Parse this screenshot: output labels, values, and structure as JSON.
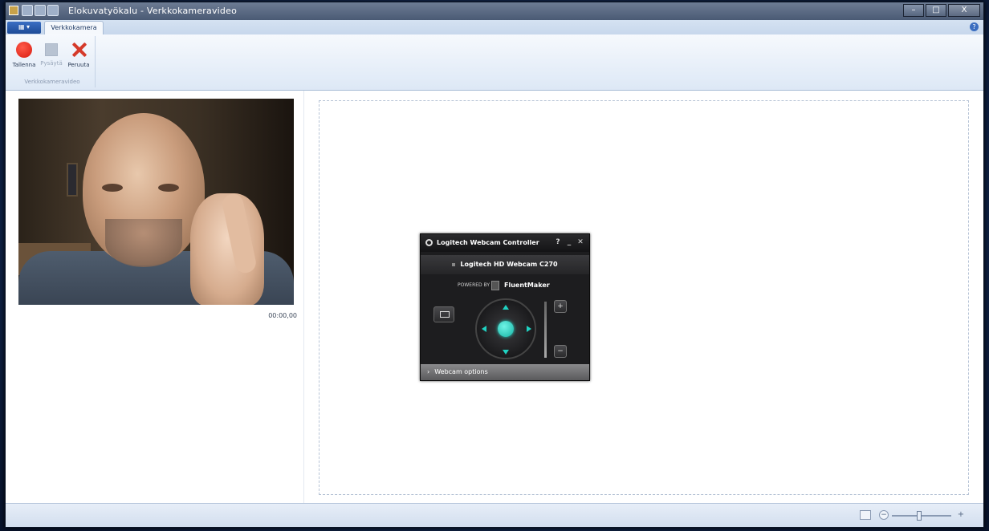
{
  "titlebar": {
    "title": "Elokuvatyökalu - Verkkokameravideo",
    "minimize_label": "–",
    "maximize_label": "□",
    "close_label": "X"
  },
  "ribbon": {
    "app_menu_label": "▦ ▾",
    "active_tab": "Verkkokamera",
    "help_label": "?",
    "group_label": "Verkkokameravideo",
    "buttons": {
      "record": "Tallenna",
      "stop": "Pysäytä",
      "cancel": "Peruuta"
    }
  },
  "preview": {
    "timecode": "00:00,00"
  },
  "webcam_controller": {
    "title": "Logitech Webcam Controller",
    "help_label": "?",
    "minimize_label": "_",
    "close_label": "✕",
    "camera_name": "Logitech HD Webcam C270",
    "fx_label": "POWERED BY",
    "fx_name": "FluentMaker",
    "zoom_in_label": "+",
    "zoom_out_label": "−",
    "options_chevron": "›",
    "options_label": "Webcam options"
  },
  "statusbar": {
    "zoom_minus_label": "−",
    "zoom_plus_label": "+",
    "zoom_level": 0.45
  },
  "colors": {
    "record": "#d81c10",
    "cancel": "#d53a2a",
    "pan_accent": "#1fd2c2",
    "ribbon_bg": "#dde8f6"
  }
}
